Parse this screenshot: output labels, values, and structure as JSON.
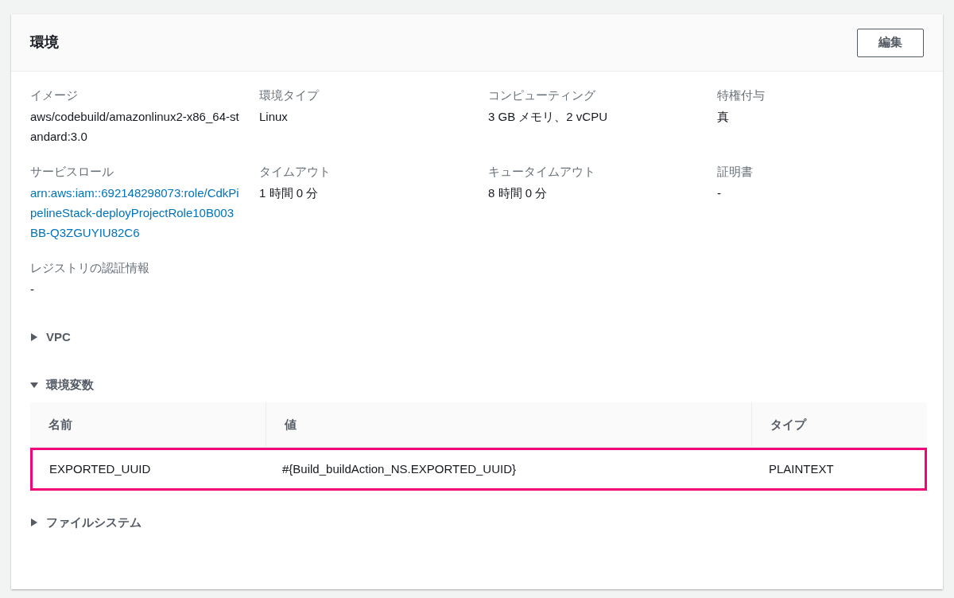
{
  "panel": {
    "title": "環境",
    "edit_button": "編集"
  },
  "fields": [
    {
      "label": "イメージ",
      "value": "aws/codebuild/amazonlinux2-x86_64-standard:3.0",
      "kind": "text"
    },
    {
      "label": "環境タイプ",
      "value": "Linux",
      "kind": "text"
    },
    {
      "label": "コンピューティング",
      "value": "3 GB メモリ、2 vCPU",
      "kind": "text"
    },
    {
      "label": "特権付与",
      "value": "真",
      "kind": "text"
    },
    {
      "label": "サービスロール",
      "value": "arn:aws:iam::692148298073:role/CdkPipelineStack-deployProjectRole10B003BB-Q3ZGUYIU82C6",
      "kind": "link"
    },
    {
      "label": "タイムアウト",
      "value": "1 時間 0 分",
      "kind": "text"
    },
    {
      "label": "キュータイムアウト",
      "value": "8 時間 0 分",
      "kind": "text"
    },
    {
      "label": "証明書",
      "value": "-",
      "kind": "text"
    },
    {
      "label": "レジストリの認証情報",
      "value": "-",
      "kind": "text"
    }
  ],
  "sections": [
    {
      "title": "VPC",
      "expanded": false
    },
    {
      "title": "環境変数",
      "expanded": true,
      "table": {
        "columns": [
          "名前",
          "値",
          "タイプ"
        ],
        "rows": [
          {
            "cells": [
              "EXPORTED_UUID",
              "#{Build_buildAction_NS.EXPORTED_UUID}",
              "PLAINTEXT"
            ],
            "highlighted": true
          }
        ]
      }
    },
    {
      "title": "ファイルシステム",
      "expanded": false
    }
  ]
}
